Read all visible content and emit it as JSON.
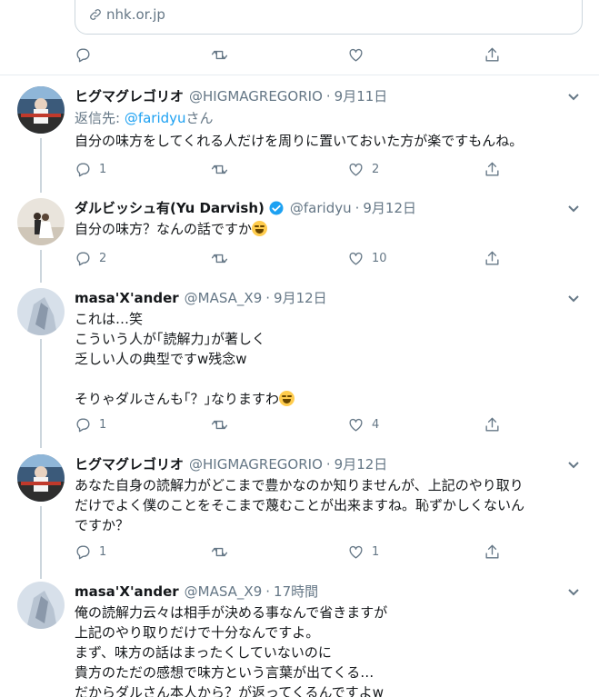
{
  "link_card": {
    "domain": "nhk.or.jp"
  },
  "top_actions": {
    "reply_count": "",
    "retweet_count": "",
    "like_count": ""
  },
  "tweets": [
    {
      "name": "ヒグマグレゴリオ",
      "handle": "@HIGMAGREGORIO",
      "time": "9月11日",
      "reply_prefix": "返信先: ",
      "reply_mention": "@faridyu",
      "reply_suffix": "さん",
      "text": "自分の味方をしてくれる人だけを周りに置いておいた方が楽ですもんね。",
      "reply_count": "1",
      "retweet_count": "",
      "like_count": "2"
    },
    {
      "name": "ダルビッシュ有(Yu Darvish)",
      "handle": "@faridyu",
      "time": "9月12日",
      "text": "自分の味方？なんの話ですか",
      "reply_count": "2",
      "retweet_count": "",
      "like_count": "10"
    },
    {
      "name": "masa'X'ander",
      "handle": "@MASA_X9",
      "time": "9月12日",
      "text": "これは…笑\nこういう人が｢読解力｣が著しく\n乏しい人の典型ですw残念w\n\nそりゃダルさんも｢？｣なりますわ",
      "reply_count": "1",
      "retweet_count": "",
      "like_count": "4"
    },
    {
      "name": "ヒグマグレゴリオ",
      "handle": "@HIGMAGREGORIO",
      "time": "9月12日",
      "text": "あなた自身の読解力がどこまで豊かなのか知りませんが、上記のやり取り\nだけでよく僕のことをそこまで蔑むことが出来ますね。恥ずかしくないん\nですか？",
      "reply_count": "1",
      "retweet_count": "",
      "like_count": "1"
    },
    {
      "name": "masa'X'ander",
      "handle": "@MASA_X9",
      "time": "17時間",
      "text": "俺の読解力云々は相手が決める事なんで省きますが\n上記のやり取りだけで十分なんですよ。\nまず、味方の話はまったくしていないのに\n貴方のただの感想で味方という言葉が出てくる…\nだからダルさん本人から？が返ってくるんですよw"
    }
  ],
  "colors": {
    "accent": "#1da1f2",
    "muted": "#657786",
    "border": "#e6ecf0",
    "verified": "#1da1f2"
  }
}
